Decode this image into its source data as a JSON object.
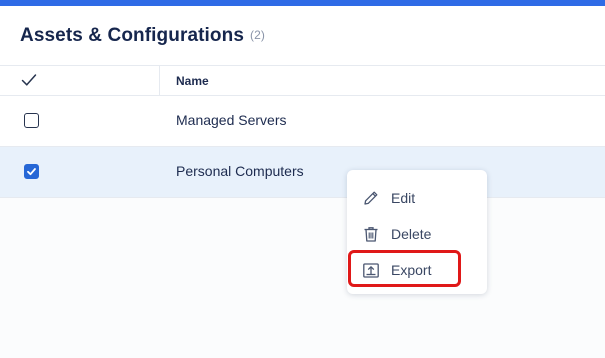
{
  "header": {
    "title": "Assets & Configurations",
    "count": "(2)"
  },
  "table": {
    "columns": [
      "Name"
    ],
    "rows": [
      {
        "name": "Managed Servers",
        "checked": false
      },
      {
        "name": "Personal Computers",
        "checked": true
      }
    ]
  },
  "context_menu": {
    "items": [
      {
        "label": "Edit",
        "icon": "pencil-icon"
      },
      {
        "label": "Delete",
        "icon": "trash-icon"
      },
      {
        "label": "Export",
        "icon": "export-icon"
      }
    ],
    "highlighted": "Export"
  },
  "colors": {
    "accent": "#2f6be6",
    "selected_row": "#e8f1fb",
    "highlight": "#e01818"
  }
}
